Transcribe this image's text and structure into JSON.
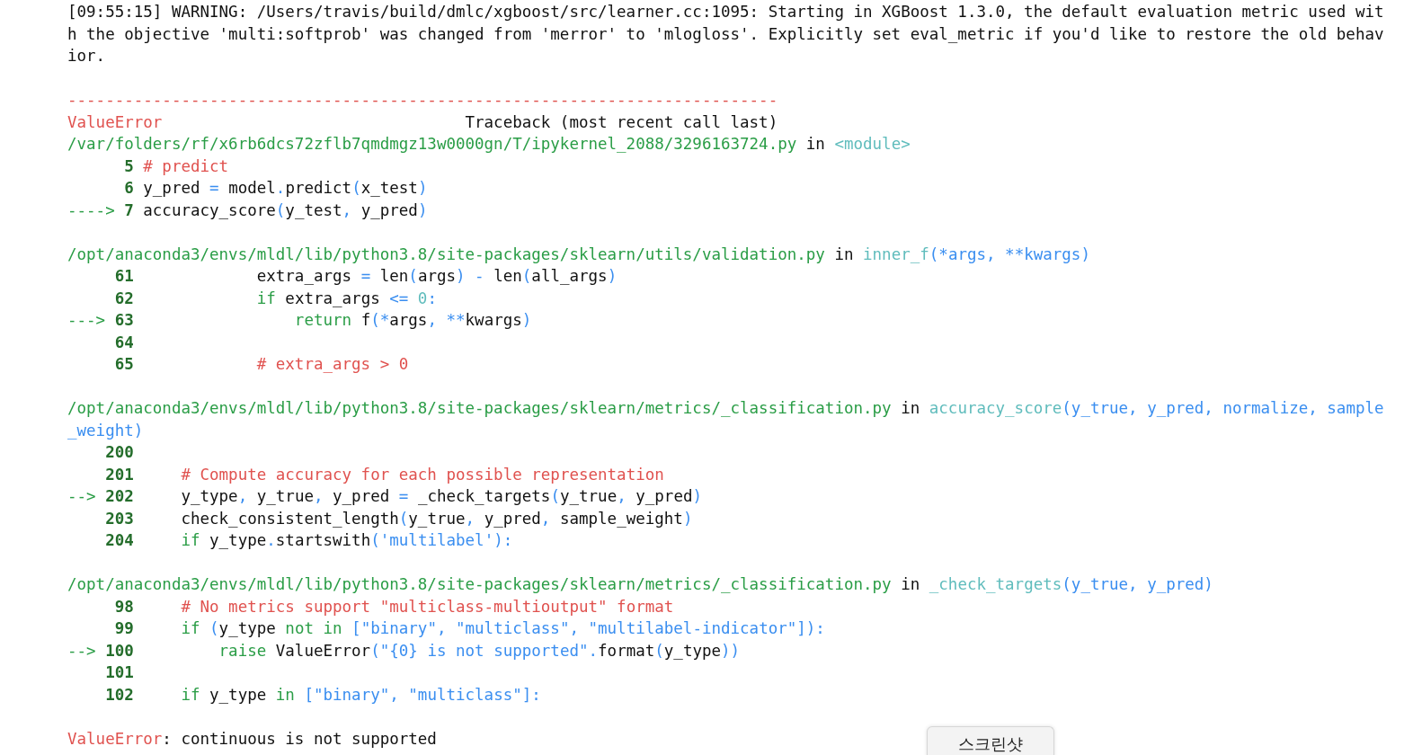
{
  "warning": "[09:55:15] WARNING: /Users/travis/build/dmlc/xgboost/src/learner.cc:1095: Starting in XGBoost 1.3.0, the default evaluation metric used with the objective 'multi:softprob' was changed from 'merror' to 'mlogloss'. Explicitly set eval_metric if you'd like to restore the old behavior.",
  "separator": "---------------------------------------------------------------------------",
  "header": {
    "error": "ValueError",
    "title": "Traceback (most recent call last)"
  },
  "frames": [
    {
      "path": "/var/folders/rf/x6rb6dcs72zflb7qmdmgz13w0000gn/T/ipykernel_2088/3296163724.py",
      "in": "in",
      "func": "<module>",
      "lines": [
        {
          "number": "5",
          "code": [
            {
              "kind": "comment",
              "text": "# predict"
            }
          ]
        },
        {
          "number": "6",
          "code": [
            {
              "kind": "plain",
              "text": "y_pred "
            },
            {
              "kind": "op",
              "text": "="
            },
            {
              "kind": "plain",
              "text": " model"
            },
            {
              "kind": "op",
              "text": "."
            },
            {
              "kind": "plain",
              "text": "predict"
            },
            {
              "kind": "op",
              "text": "("
            },
            {
              "kind": "plain",
              "text": "x_test"
            },
            {
              "kind": "op",
              "text": ")"
            }
          ]
        },
        {
          "arrow": "---->",
          "number": "7",
          "code": [
            {
              "kind": "plain",
              "text": "accuracy_score"
            },
            {
              "kind": "op",
              "text": "("
            },
            {
              "kind": "plain",
              "text": "y_test"
            },
            {
              "kind": "op",
              "text": ","
            },
            {
              "kind": "plain",
              "text": " y_pred"
            },
            {
              "kind": "op",
              "text": ")"
            }
          ]
        }
      ]
    },
    {
      "path": "/opt/anaconda3/envs/mldl/lib/python3.8/site-packages/sklearn/utils/validation.py",
      "in": "in",
      "func": "inner_f",
      "args": "(*args, **kwargs)",
      "lines": [
        {
          "number": "61",
          "code": [
            {
              "kind": "plain",
              "text": "            extra_args "
            },
            {
              "kind": "op",
              "text": "="
            },
            {
              "kind": "plain",
              "text": " len"
            },
            {
              "kind": "op",
              "text": "("
            },
            {
              "kind": "plain",
              "text": "args"
            },
            {
              "kind": "op",
              "text": ")"
            },
            {
              "kind": "op",
              "text": " -"
            },
            {
              "kind": "plain",
              "text": " len"
            },
            {
              "kind": "op",
              "text": "("
            },
            {
              "kind": "plain",
              "text": "all_args"
            },
            {
              "kind": "op",
              "text": ")"
            }
          ]
        },
        {
          "number": "62",
          "code": [
            {
              "kind": "keyword",
              "text": "            if"
            },
            {
              "kind": "plain",
              "text": " extra_args "
            },
            {
              "kind": "op",
              "text": "<="
            },
            {
              "kind": "number",
              "text": " 0"
            },
            {
              "kind": "op",
              "text": ":"
            }
          ]
        },
        {
          "arrow": "--->",
          "number": "63",
          "code": [
            {
              "kind": "keyword",
              "text": "                return"
            },
            {
              "kind": "plain",
              "text": " f"
            },
            {
              "kind": "op",
              "text": "(*"
            },
            {
              "kind": "plain",
              "text": "args"
            },
            {
              "kind": "op",
              "text": ","
            },
            {
              "kind": "op",
              "text": " **"
            },
            {
              "kind": "plain",
              "text": "kwargs"
            },
            {
              "kind": "op",
              "text": ")"
            }
          ]
        },
        {
          "number": "64"
        },
        {
          "number": "65",
          "code": [
            {
              "kind": "comment",
              "text": "            # extra_args > 0"
            }
          ]
        }
      ]
    },
    {
      "path": "/opt/anaconda3/envs/mldl/lib/python3.8/site-packages/sklearn/metrics/_classification.py",
      "in": "in",
      "func": "accuracy_score",
      "args": "(y_true, y_pred, normalize, sample_weight)",
      "lines": [
        {
          "number": "200"
        },
        {
          "number": "201",
          "code": [
            {
              "kind": "comment",
              "text": "    # Compute accuracy for each possible representation"
            }
          ]
        },
        {
          "arrow": "-->",
          "number": "202",
          "code": [
            {
              "kind": "plain",
              "text": "    y_type"
            },
            {
              "kind": "op",
              "text": ","
            },
            {
              "kind": "plain",
              "text": " y_true"
            },
            {
              "kind": "op",
              "text": ","
            },
            {
              "kind": "plain",
              "text": " y_pred "
            },
            {
              "kind": "op",
              "text": "="
            },
            {
              "kind": "plain",
              "text": " _check_targets"
            },
            {
              "kind": "op",
              "text": "("
            },
            {
              "kind": "plain",
              "text": "y_true"
            },
            {
              "kind": "op",
              "text": ","
            },
            {
              "kind": "plain",
              "text": " y_pred"
            },
            {
              "kind": "op",
              "text": ")"
            }
          ]
        },
        {
          "number": "203",
          "code": [
            {
              "kind": "plain",
              "text": "    check_consistent_length"
            },
            {
              "kind": "op",
              "text": "("
            },
            {
              "kind": "plain",
              "text": "y_true"
            },
            {
              "kind": "op",
              "text": ","
            },
            {
              "kind": "plain",
              "text": " y_pred"
            },
            {
              "kind": "op",
              "text": ","
            },
            {
              "kind": "plain",
              "text": " sample_weight"
            },
            {
              "kind": "op",
              "text": ")"
            }
          ]
        },
        {
          "number": "204",
          "code": [
            {
              "kind": "keyword",
              "text": "    if"
            },
            {
              "kind": "plain",
              "text": " y_type"
            },
            {
              "kind": "op",
              "text": "."
            },
            {
              "kind": "plain",
              "text": "startswith"
            },
            {
              "kind": "op",
              "text": "("
            },
            {
              "kind": "string",
              "text": "'multilabel'"
            },
            {
              "kind": "op",
              "text": "):"
            }
          ]
        }
      ]
    },
    {
      "path": "/opt/anaconda3/envs/mldl/lib/python3.8/site-packages/sklearn/metrics/_classification.py",
      "in": "in",
      "func": "_check_targets",
      "args": "(y_true, y_pred)",
      "lines": [
        {
          "number": "98",
          "code": [
            {
              "kind": "comment",
              "text": "    # No metrics support \"multiclass-multioutput\" format"
            }
          ]
        },
        {
          "number": "99",
          "code": [
            {
              "kind": "keyword",
              "text": "    if"
            },
            {
              "kind": "op",
              "text": " ("
            },
            {
              "kind": "plain",
              "text": "y_type "
            },
            {
              "kind": "keyword",
              "text": "not in"
            },
            {
              "kind": "string",
              "text": " [\"binary\", \"multiclass\", \"multilabel-indicator\"]):"
            }
          ]
        },
        {
          "arrow": "-->",
          "number": "100",
          "code": [
            {
              "kind": "keyword",
              "text": "        raise"
            },
            {
              "kind": "plain",
              "text": " ValueError"
            },
            {
              "kind": "op",
              "text": "("
            },
            {
              "kind": "string",
              "text": "\"{0} is not supported\""
            },
            {
              "kind": "op",
              "text": "."
            },
            {
              "kind": "plain",
              "text": "format"
            },
            {
              "kind": "op",
              "text": "("
            },
            {
              "kind": "plain",
              "text": "y_type"
            },
            {
              "kind": "op",
              "text": "))"
            }
          ]
        },
        {
          "number": "101"
        },
        {
          "number": "102",
          "code": [
            {
              "kind": "keyword",
              "text": "    if"
            },
            {
              "kind": "plain",
              "text": " y_type "
            },
            {
              "kind": "keyword",
              "text": "in"
            },
            {
              "kind": "string",
              "text": " [\"binary\", \"multiclass\"]:"
            }
          ]
        }
      ]
    }
  ],
  "error": {
    "type": "ValueError",
    "message": ": continuous is not supported"
  },
  "popup_button": "스크린샷"
}
